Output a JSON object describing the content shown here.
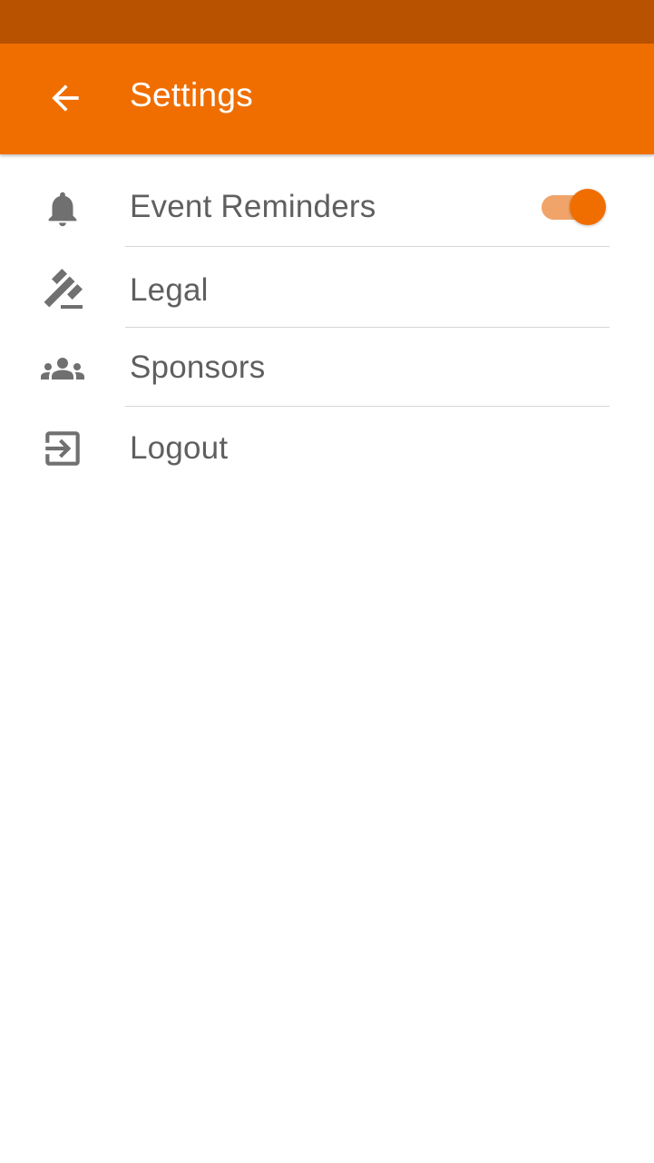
{
  "app_bar": {
    "title": "Settings",
    "back_icon": "arrow-left-icon"
  },
  "settings": {
    "items": [
      {
        "label": "Event Reminders",
        "icon": "bell-icon",
        "toggle_on": true
      },
      {
        "label": "Legal",
        "icon": "gavel-icon"
      },
      {
        "label": "Sponsors",
        "icon": "people-icon"
      },
      {
        "label": "Logout",
        "icon": "exit-icon"
      }
    ]
  },
  "colors": {
    "status_bar": "#b95200",
    "app_bar": "#f06e00",
    "accent": "#f06e00",
    "toggle_track": "#f0a46a",
    "icon": "#707070",
    "text": "#5f5f5f"
  }
}
